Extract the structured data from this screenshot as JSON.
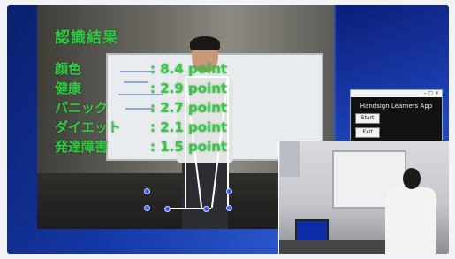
{
  "overlay": {
    "title": "認識結果",
    "rows": [
      {
        "label": "顔色",
        "value": ": 8.4 point"
      },
      {
        "label": "健康",
        "value": ": 2.9 point"
      },
      {
        "label": "パニック",
        "value": ": 2.7 point"
      },
      {
        "label": "ダイエット",
        "value": ": 2.1 point"
      },
      {
        "label": "発達障害",
        "value": ": 1.5 point"
      }
    ]
  },
  "app_window": {
    "title": "Handsign Learners App",
    "start_label": "Start",
    "exit_label": "Exit",
    "window_controls": "– □ ×"
  },
  "colors": {
    "overlay_text": "#2ecc40",
    "background_accent": "#1538a6",
    "skeleton_joint": "#3b5bff"
  }
}
